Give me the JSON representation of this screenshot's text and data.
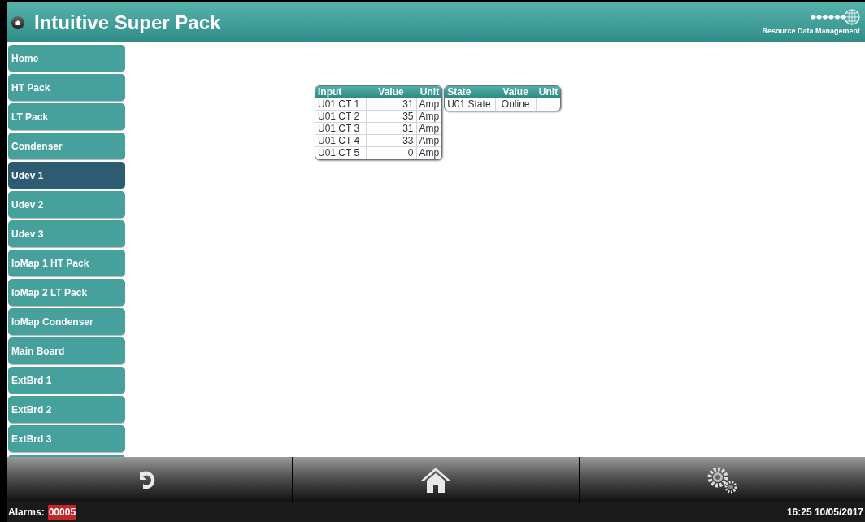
{
  "header": {
    "title": "Intuitive Super Pack",
    "logo_text": "Resource Data Management"
  },
  "sidebar": {
    "items": [
      {
        "label": "Home",
        "selected": false
      },
      {
        "label": "HT Pack",
        "selected": false
      },
      {
        "label": "LT Pack",
        "selected": false
      },
      {
        "label": "Condenser",
        "selected": false
      },
      {
        "label": "Udev 1",
        "selected": true
      },
      {
        "label": "Udev 2",
        "selected": false
      },
      {
        "label": "Udev 3",
        "selected": false
      },
      {
        "label": "IoMap 1 HT Pack",
        "selected": false
      },
      {
        "label": "IoMap 2 LT Pack",
        "selected": false
      },
      {
        "label": "IoMap Condenser",
        "selected": false
      },
      {
        "label": "Main Board",
        "selected": false
      },
      {
        "label": "ExtBrd 1",
        "selected": false
      },
      {
        "label": "ExtBrd 2",
        "selected": false
      },
      {
        "label": "ExtBrd 3",
        "selected": false
      }
    ]
  },
  "tables": [
    {
      "columns": [
        "Input",
        "Value",
        "Unit"
      ],
      "rows": [
        [
          "U01 CT 1",
          "31",
          "Amp"
        ],
        [
          "U01 CT 2",
          "35",
          "Amp"
        ],
        [
          "U01 CT 3",
          "31",
          "Amp"
        ],
        [
          "U01 CT 4",
          "33",
          "Amp"
        ],
        [
          "U01 CT 5",
          "0",
          "Amp"
        ]
      ]
    },
    {
      "columns": [
        "State",
        "Value",
        "Unit"
      ],
      "rows": [
        [
          "U01 State",
          "Online",
          ""
        ]
      ]
    }
  ],
  "status_bar": {
    "alarms_label": "Alarms:",
    "alarms_count": "00005",
    "datetime": "16:25 10/05/2017"
  }
}
